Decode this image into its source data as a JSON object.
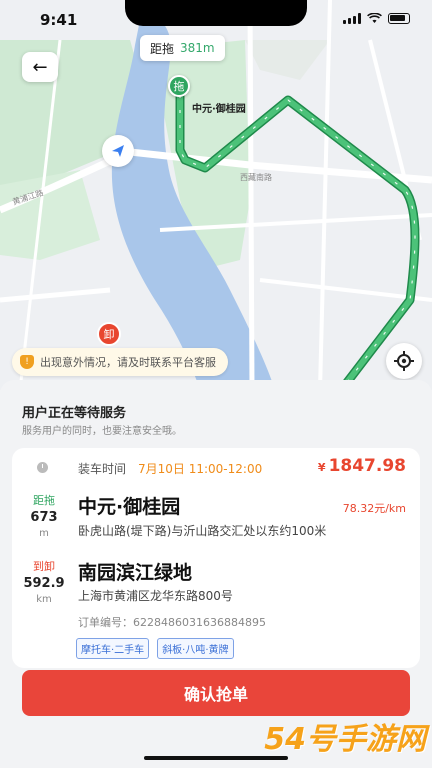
{
  "status": {
    "time": "9:41"
  },
  "map": {
    "distance_label": "距拖",
    "distance_value": "381m",
    "pickup_marker": "拖",
    "pickup_name": "中元·御桂园",
    "road_labels": [
      "西藏南路",
      "黄浦江路"
    ],
    "destination_marker": "卸",
    "notice": "出现意外情况，请及时联系平台客服",
    "route_color": "#2fa560"
  },
  "panel": {
    "wait_title": "用户正在等待服务",
    "wait_subtitle": "服务用户的同时，也要注意安全哦。",
    "load_time_label": "装车时间",
    "load_time_value": "7月10日 11:00-12:00",
    "price_symbol": "¥",
    "price": "1847.98",
    "pickup": {
      "dist_label": "距拖",
      "dist_num": "673",
      "dist_unit": "m",
      "name": "中元·御桂园",
      "detail": "卧虎山路(堤下路)与沂山路交汇处以东约100米"
    },
    "unit_price": "78.32元/km",
    "dropoff": {
      "dist_label": "到卸",
      "dist_num": "592.9",
      "dist_unit": "km",
      "name": "南园滨江绿地",
      "detail": "上海市黄浦区龙华东路800号"
    },
    "order_no": "订单编号：6228486031636884895",
    "tags": [
      "摩托车·二手车",
      "斜板·八吨·黄牌"
    ],
    "grab_button": "确认抢单"
  },
  "watermark": "54号手游网",
  "colors": {
    "accent_red": "#e9453a",
    "route_green": "#2fa560",
    "time_orange": "#f08c1a"
  }
}
